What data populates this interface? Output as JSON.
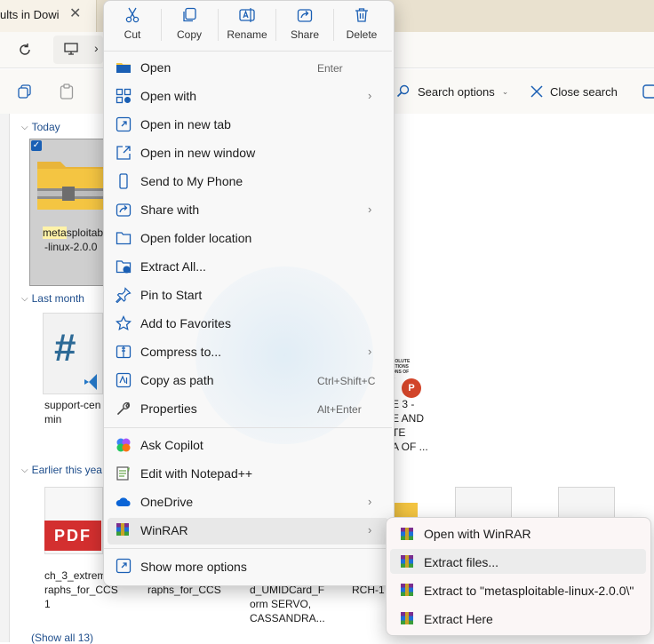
{
  "browser_tab": {
    "title": "ults in Dowi",
    "close": "✕"
  },
  "toolbar": {
    "search_options": "Search options",
    "close_search": "Close search"
  },
  "groups": {
    "today": "Today",
    "last_month": "Last month",
    "earlier": "Earlier this yea",
    "show_all": "(Show all 13)"
  },
  "files": {
    "zip_name_highlight": "meta",
    "zip_name_rest": "sploitab",
    "zip_name_line2": "-linux-2.0.0",
    "support_line1": "support-cen",
    "support_line2": "min",
    "ppt_line1": "E 3 -",
    "ppt_line2": "E AND",
    "ppt_line3": "TE",
    "ppt_line4": "A OF ...",
    "ppt_thumb_text": "SOLUTE\nCTIONS\nONS OF\nE",
    "ch3_line1": "ch_3_extrem",
    "ch3_line2": "raphs_for_CCS",
    "ch3_line3": "1",
    "graphs2": "raphs_for_CCS",
    "umid_line1": "d_UMIDCard_F",
    "umid_line2": "orm SERVO,",
    "umid_line3": "CASSANDRA...",
    "rch": "RCH-1",
    "pdf_badge": "PDF"
  },
  "quick_actions": [
    {
      "label": "Cut",
      "icon": "scissors-icon"
    },
    {
      "label": "Copy",
      "icon": "copy-icon"
    },
    {
      "label": "Rename",
      "icon": "rename-icon"
    },
    {
      "label": "Share",
      "icon": "share-icon"
    },
    {
      "label": "Delete",
      "icon": "trash-icon"
    }
  ],
  "menu": {
    "open": {
      "label": "Open",
      "shortcut": "Enter"
    },
    "open_with": {
      "label": "Open with"
    },
    "open_new_tab": {
      "label": "Open in new tab"
    },
    "open_new_window": {
      "label": "Open in new window"
    },
    "send_phone": {
      "label": "Send to My Phone"
    },
    "share_with": {
      "label": "Share with"
    },
    "open_folder_location": {
      "label": "Open folder location"
    },
    "extract_all": {
      "label": "Extract All..."
    },
    "pin_start": {
      "label": "Pin to Start"
    },
    "add_favorites": {
      "label": "Add to Favorites"
    },
    "compress": {
      "label": "Compress to..."
    },
    "copy_path": {
      "label": "Copy as path",
      "shortcut": "Ctrl+Shift+C"
    },
    "properties": {
      "label": "Properties",
      "shortcut": "Alt+Enter"
    },
    "ask_copilot": {
      "label": "Ask Copilot"
    },
    "notepad": {
      "label": "Edit with Notepad++"
    },
    "onedrive": {
      "label": "OneDrive"
    },
    "winrar": {
      "label": "WinRAR"
    },
    "show_more": {
      "label": "Show more options"
    }
  },
  "winrar_submenu": {
    "open_with": "Open with WinRAR",
    "extract_files": "Extract files...",
    "extract_to": "Extract to \"metasploitable-linux-2.0.0\\\"",
    "extract_here": "Extract Here"
  },
  "colors": {
    "accent": "#1a5fb4",
    "folder": "#f4c542",
    "pdf_red": "#d32f2f",
    "link": "#1f4e8c"
  }
}
